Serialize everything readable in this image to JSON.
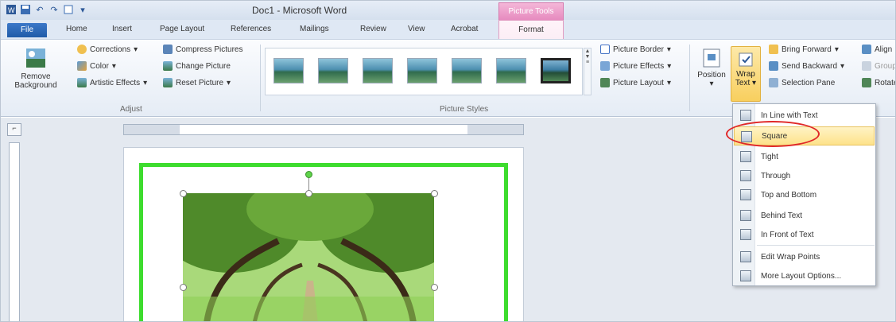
{
  "window": {
    "title": "Doc1 - Microsoft Word"
  },
  "contextual_tab_group": "Picture Tools",
  "tabs": [
    "File",
    "Home",
    "Insert",
    "Page Layout",
    "References",
    "Mailings",
    "Review",
    "View",
    "Acrobat",
    "Format"
  ],
  "active_tab": "Format",
  "ribbon": {
    "adjust": {
      "remove_background": "Remove Background",
      "corrections": "Corrections",
      "color": "Color",
      "artistic_effects": "Artistic Effects",
      "compress_pictures": "Compress Pictures",
      "change_picture": "Change Picture",
      "reset_picture": "Reset Picture",
      "group_label": "Adjust"
    },
    "picture_styles": {
      "group_label": "Picture Styles",
      "picture_border": "Picture Border",
      "picture_effects": "Picture Effects",
      "picture_layout": "Picture Layout"
    },
    "arrange": {
      "position": "Position",
      "wrap_text": "Wrap Text",
      "bring_forward": "Bring Forward",
      "send_backward": "Send Backward",
      "selection_pane": "Selection Pane",
      "align": "Align",
      "group": "Group",
      "rotate": "Rotate"
    }
  },
  "wrap_menu": {
    "items": [
      "In Line with Text",
      "Square",
      "Tight",
      "Through",
      "Top and Bottom",
      "Behind Text",
      "In Front of Text",
      "Edit Wrap Points",
      "More Layout Options..."
    ],
    "highlighted": "Square"
  },
  "colors": {
    "accent_pink": "#e68bbf",
    "selection_green": "#3ddc2e",
    "highlight_yellow": "#fde28a",
    "annotation_red": "#e02828"
  }
}
